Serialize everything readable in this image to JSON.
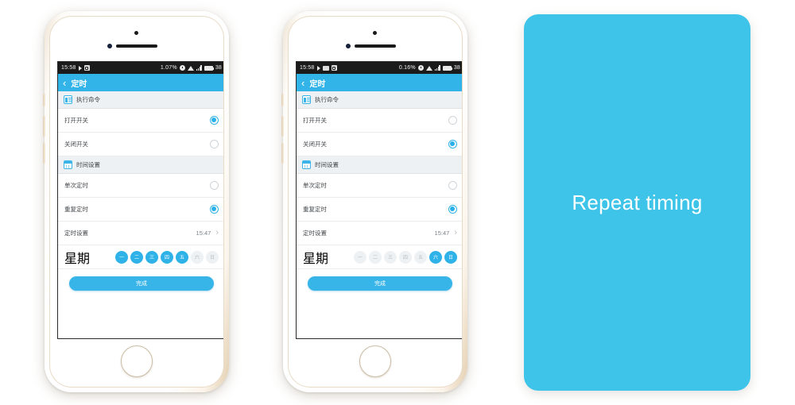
{
  "colors": {
    "accent": "#33b4e8",
    "panel": "#3ec4e9",
    "radio_on": "#29b0ea",
    "day_on": "#2fb2e8",
    "day_off": "#eef1f3",
    "section_bg": "#eef1f3"
  },
  "phones": [
    {
      "name": "phone-left",
      "statusbar": {
        "time": "15:58",
        "icons_left": [
          "play-icon",
          "box-icon"
        ],
        "data_rate": "1.07%",
        "icons_right": [
          "clock-icon",
          "wifi-icon",
          "signal-icon",
          "battery-icon"
        ],
        "battery_level": "38"
      },
      "navbar": {
        "back": "‹",
        "title": "定时"
      },
      "sections": [
        {
          "icon": "list-icon",
          "title": "执行命令"
        }
      ],
      "command_rows": [
        {
          "label": "打开开关",
          "selected": true
        },
        {
          "label": "关闭开关",
          "selected": false
        }
      ],
      "time_section": {
        "icon": "calendar-icon",
        "title": "时间设置"
      },
      "time_rows": [
        {
          "label": "单次定时",
          "selected": false
        },
        {
          "label": "重复定时",
          "selected": true
        }
      ],
      "timer_row": {
        "label": "定时设置",
        "value": "15:47",
        "chevron": "›"
      },
      "week_row": {
        "label": "星期",
        "days": [
          {
            "label": "一",
            "selected": true
          },
          {
            "label": "二",
            "selected": true
          },
          {
            "label": "三",
            "selected": true
          },
          {
            "label": "四",
            "selected": true
          },
          {
            "label": "五",
            "selected": true
          },
          {
            "label": "六",
            "selected": false
          },
          {
            "label": "日",
            "selected": false
          }
        ]
      },
      "done_button": "完成"
    },
    {
      "name": "phone-right",
      "statusbar": {
        "time": "15:58",
        "icons_left": [
          "play-icon",
          "image-icon",
          "box-icon"
        ],
        "data_rate": "0.16%",
        "icons_right": [
          "clock-icon",
          "wifi-icon",
          "signal-icon",
          "battery-icon"
        ],
        "battery_level": "38"
      },
      "navbar": {
        "back": "‹",
        "title": "定时"
      },
      "sections": [
        {
          "icon": "list-icon",
          "title": "执行命令"
        }
      ],
      "command_rows": [
        {
          "label": "打开开关",
          "selected": false
        },
        {
          "label": "关闭开关",
          "selected": true
        }
      ],
      "time_section": {
        "icon": "calendar-icon",
        "title": "时间设置"
      },
      "time_rows": [
        {
          "label": "单次定时",
          "selected": false
        },
        {
          "label": "重复定时",
          "selected": true
        }
      ],
      "timer_row": {
        "label": "定时设置",
        "value": "15:47",
        "chevron": "›"
      },
      "week_row": {
        "label": "星期",
        "days": [
          {
            "label": "一",
            "selected": false
          },
          {
            "label": "二",
            "selected": false
          },
          {
            "label": "三",
            "selected": false
          },
          {
            "label": "四",
            "selected": false
          },
          {
            "label": "五",
            "selected": false
          },
          {
            "label": "六",
            "selected": true
          },
          {
            "label": "日",
            "selected": true
          }
        ]
      },
      "done_button": "完成"
    }
  ],
  "panel": {
    "label": "Repeat timing"
  }
}
